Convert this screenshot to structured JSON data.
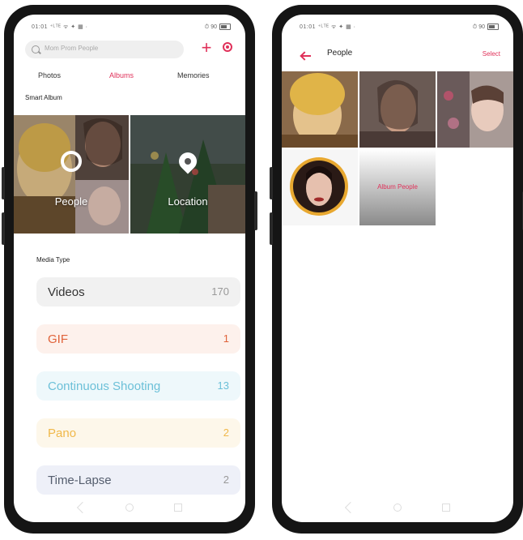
{
  "left_screen": {
    "status": {
      "left": "01:01 ⁺ᴸᵀᴱ ᯤ ✦ ▦ ·",
      "right": "⏱ 90"
    },
    "search": {
      "placeholder": "Mom Prom People"
    },
    "tabs": [
      {
        "label": "Photos"
      },
      {
        "label": "Albums"
      },
      {
        "label": "Memories"
      }
    ],
    "smart_album": {
      "heading": "Smart Album",
      "albums": [
        {
          "label": "People",
          "icon": "person-circle-icon"
        },
        {
          "label": "Location",
          "icon": "location-pin-icon"
        }
      ]
    },
    "media_type": {
      "heading": "Media Type",
      "items": [
        {
          "label": "Videos",
          "count": "170",
          "color": "#333333",
          "bg": "#f1f1f1"
        },
        {
          "label": "GIF",
          "count": "1",
          "color": "#e0633a",
          "bg": "#fdf1ec"
        },
        {
          "label": "Continuous Shooting",
          "count": "13",
          "color": "#6cc0d8",
          "bg": "#eef8fb"
        },
        {
          "label": "Pano",
          "count": "2",
          "color": "#f0b84a",
          "bg": "#fdf7ea"
        },
        {
          "label": "Time-Lapse",
          "count": "2",
          "color": "#555e6e",
          "bg": "#eef0f8"
        }
      ]
    }
  },
  "right_screen": {
    "status": {
      "left": "01:01 ⁺ᴸᵀᴱ ᯤ ✦ ▦ ·",
      "right": "⏱ 90"
    },
    "title": "People",
    "select_label": "Select",
    "add_people_label": "Album People"
  },
  "colors": {
    "accent": "#e0315a"
  }
}
